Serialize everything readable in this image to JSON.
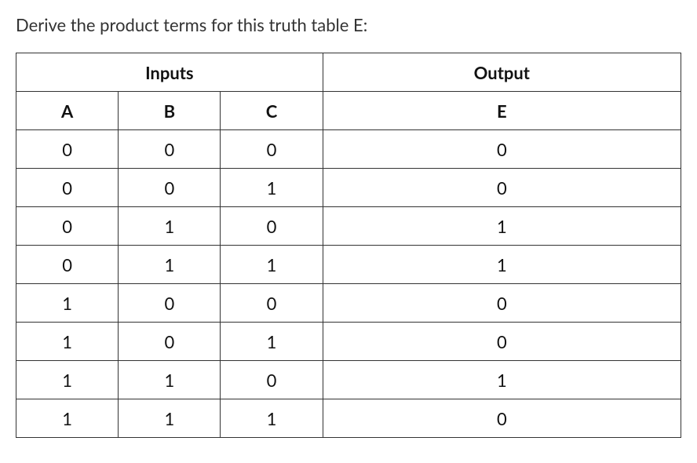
{
  "prompt": "Derive the product terms for this truth table E:",
  "headers": {
    "group_inputs": "Inputs",
    "group_output": "Output",
    "col_a": "A",
    "col_b": "B",
    "col_c": "C",
    "col_e": "E"
  },
  "rows": [
    {
      "a": 0,
      "b": 0,
      "c": 0,
      "e": 0
    },
    {
      "a": 0,
      "b": 0,
      "c": 1,
      "e": 0
    },
    {
      "a": 0,
      "b": 1,
      "c": 0,
      "e": 1
    },
    {
      "a": 0,
      "b": 1,
      "c": 1,
      "e": 1
    },
    {
      "a": 1,
      "b": 0,
      "c": 0,
      "e": 0
    },
    {
      "a": 1,
      "b": 0,
      "c": 1,
      "e": 0
    },
    {
      "a": 1,
      "b": 1,
      "c": 0,
      "e": 1
    },
    {
      "a": 1,
      "b": 1,
      "c": 1,
      "e": 0
    }
  ]
}
